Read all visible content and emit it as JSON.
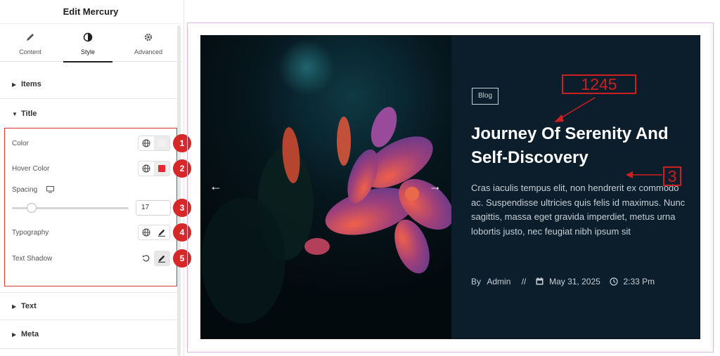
{
  "panel": {
    "title": "Edit Mercury",
    "tabs": [
      {
        "label": "Content",
        "icon": "pencil-icon"
      },
      {
        "label": "Style",
        "icon": "half-circle-icon"
      },
      {
        "label": "Advanced",
        "icon": "gear-icon"
      }
    ],
    "sections": {
      "items": "Items",
      "title": "Title",
      "text": "Text",
      "meta": "Meta"
    },
    "controls": {
      "color": {
        "label": "Color",
        "swatch": "#f2f2f2"
      },
      "hover_color": {
        "label": "Hover Color",
        "swatch": "#e0282f"
      },
      "spacing": {
        "label": "Spacing",
        "value": "17",
        "slider_level_percent": 17
      },
      "typography": {
        "label": "Typography"
      },
      "text_shadow": {
        "label": "Text Shadow"
      }
    },
    "badges": [
      "1",
      "2",
      "3",
      "4",
      "5"
    ],
    "accent": "#d62828"
  },
  "card": {
    "tag": "Blog",
    "title": "Journey Of Serenity And Self-Discovery",
    "excerpt": "Cras iaculis tempus elit, non hendrerit ex commodo ac. Suspendisse ultricies quis felis id maximus. Nunc sagittis, massa eget gravida imperdiet, metus urna lobortis justo, nec feugiat nibh ipsum sit",
    "meta": {
      "by": "By",
      "author": "Admin",
      "separator": "//",
      "date": "May 31, 2025",
      "time": "2:33 Pm"
    },
    "prev_arrow": "←",
    "next_arrow": "→"
  },
  "annotations": {
    "title_ref": "1245",
    "excerpt_ref": "3",
    "color": "#cc1f1f"
  }
}
